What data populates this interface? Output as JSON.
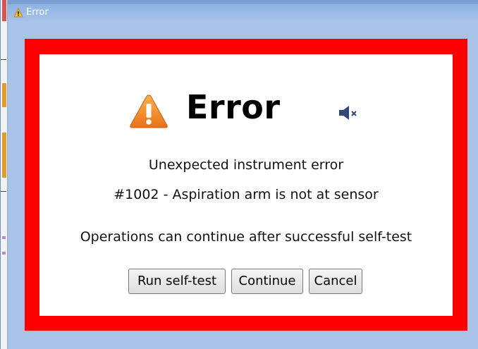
{
  "window": {
    "title": "Error",
    "title_icon": "warning-icon"
  },
  "dialog": {
    "heading": "Error",
    "heading_icon": "warning-triangle-icon",
    "sound_icon": "speaker-muted-icon",
    "message_line1": "Unexpected instrument error",
    "message_line2": "#1002 - Aspiration arm is not at sensor",
    "message_line3": "Operations can continue after successful self-test",
    "frame_color": "#ff0000",
    "warning_color": "#f28a1e"
  },
  "buttons": {
    "self_test": "Run self-test",
    "continue": "Continue",
    "cancel": "Cancel"
  }
}
